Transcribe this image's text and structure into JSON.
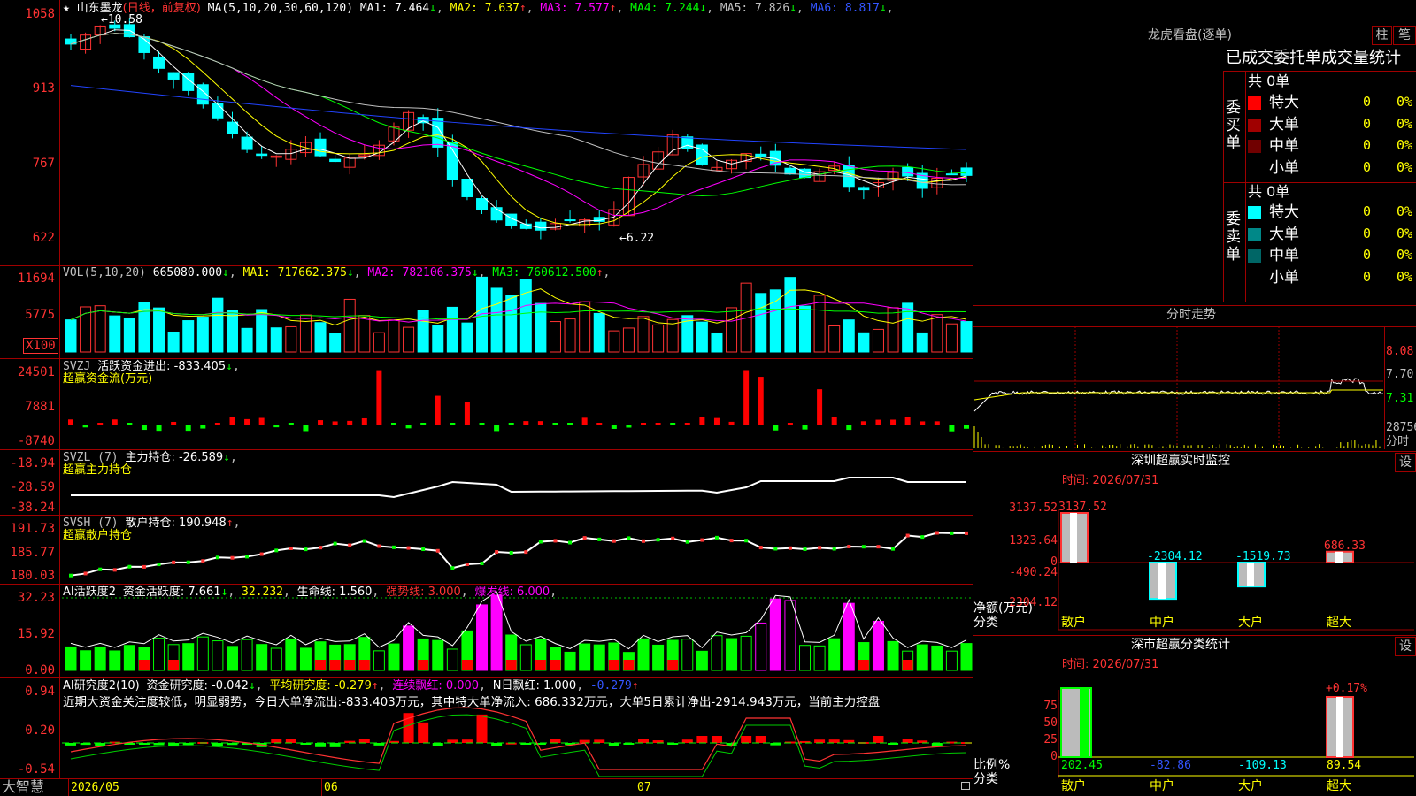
{
  "main": {
    "stock_name": "山东墨龙",
    "period": "(日线，前复权)",
    "ma_params": "MA(5,10,20,30,60,120)",
    "ma": [
      {
        "label": "MA1: 7.464",
        "arrow": "↓",
        "color": "#ffffff"
      },
      {
        "label": "MA2: 7.637",
        "arrow": "↑",
        "color": "#ffff00"
      },
      {
        "label": "MA3: 7.577",
        "arrow": "↑",
        "color": "#ff00ff"
      },
      {
        "label": "MA4: 7.244",
        "arrow": "↓",
        "color": "#00ff00"
      },
      {
        "label": "MA5: 7.826",
        "arrow": "↓",
        "color": "#c0c0c0"
      },
      {
        "label": "MA6: 8.817",
        "arrow": "↓",
        "color": "#3355ff"
      }
    ],
    "axis": [
      "1058",
      "913",
      "767",
      "622"
    ],
    "high_label": "10.58",
    "low_label": "6.22"
  },
  "vol": {
    "params": "VOL(5,10,20)",
    "value": "665080.000",
    "ma": [
      {
        "label": "MA1: 717662.375",
        "arrow": "↓",
        "color": "#ffff00"
      },
      {
        "label": "MA2: 782106.375",
        "arrow": "↓",
        "color": "#ff00ff"
      },
      {
        "label": "MA3: 760612.500",
        "arrow": "↑",
        "color": "#00ff00"
      }
    ],
    "axis": [
      "11694",
      "5775"
    ],
    "unit": "X100"
  },
  "svzj": {
    "name": "SVZJ",
    "label": "活跃资金进出: -833.405",
    "arrow": "↓",
    "sub": "超赢资金流(万元)",
    "axis": [
      "24501",
      "7881",
      "-8740"
    ]
  },
  "svzl": {
    "name": "SVZL (7)",
    "label": "主力持仓: -26.589",
    "arrow": "↓",
    "sub": "超赢主力持仓",
    "axis": [
      "-18.94",
      "-28.59",
      "-38.24"
    ]
  },
  "svsh": {
    "name": "SVSH (7)",
    "label": "散户持仓: 190.948",
    "arrow": "↑",
    "sub": "超赢散户持仓",
    "axis": [
      "191.73",
      "185.77",
      "180.03"
    ]
  },
  "ai1": {
    "name": "AI活跃度2",
    "label": "资金活跃度: 7.661",
    "v2": "32.232",
    "life": "生命线: 1.560",
    "strong": "强势线: 3.000",
    "burst": "爆发线: 6.000",
    "axis": [
      "32.23",
      "15.92",
      "0.00"
    ]
  },
  "ai2": {
    "name": "AI研究度2(10)",
    "label": "资金研究度: -0.042",
    "avg": "平均研究度: -0.279",
    "red": "连续飘红: 0.000",
    "nred": "N日飘红: 1.000",
    "last": "-0.279",
    "axis": [
      "0.94",
      "0.20",
      "-0.54"
    ],
    "summary": "近期大资金关注度较低，明显弱势，今日大单净流出:-833.403万元，其中特大单净流入: 686.332万元，大单5日累计净出-2914.943万元，当前主力控盘"
  },
  "dates": {
    "logo": "大智慧",
    "d1": "2026/05",
    "d2": "06",
    "d3": "07"
  },
  "right": {
    "title": "龙虎看盘(逐单)",
    "btn1": "柱",
    "btn2": "笔",
    "tabs": "已成交委托单成交量统计",
    "buy": {
      "side": "委买单",
      "total": "共 0单",
      "rows": [
        {
          "label": "特大",
          "v": "0",
          "p": "0%",
          "color": "#ff0000"
        },
        {
          "label": "大单",
          "v": "0",
          "p": "0%",
          "color": "#a00000"
        },
        {
          "label": "中单",
          "v": "0",
          "p": "0%",
          "color": "#700000"
        },
        {
          "label": "小单",
          "v": "0",
          "p": "0%",
          "color": "#000000"
        }
      ]
    },
    "sell": {
      "side": "委卖单",
      "total": "共 0单",
      "rows": [
        {
          "label": "特大",
          "v": "0",
          "p": "0%",
          "color": "#00ffff"
        },
        {
          "label": "大单",
          "v": "0",
          "p": "0%",
          "color": "#008888"
        },
        {
          "label": "中单",
          "v": "0",
          "p": "0%",
          "color": "#006666"
        },
        {
          "label": "小单",
          "v": "0",
          "p": "0%",
          "color": "#000000"
        }
      ]
    },
    "intraday": {
      "title": "分时走势",
      "axis": [
        "8.08",
        "7.70",
        "7.31"
      ],
      "vol": "28756",
      "unit": "分时"
    },
    "monitor": {
      "title": "深圳超赢实时监控",
      "btn": "设",
      "time": "时间: 2026/07/31",
      "axis": [
        "3137.52",
        "1323.64",
        "0",
        "-490.24",
        "-2304.12"
      ],
      "bars": [
        {
          "cat": "散户",
          "label": "3137.52",
          "value": 3137.52
        },
        {
          "cat": "中户",
          "label": "-2304.12",
          "value": -2304.12
        },
        {
          "cat": "大户",
          "label": "-1519.73",
          "value": -1519.73
        },
        {
          "cat": "超大",
          "label": "686.33",
          "value": 686.33
        }
      ],
      "unit": "净额(万元)",
      "cat_label": "分类"
    },
    "classify": {
      "title": "深市超赢分类统计",
      "btn": "设",
      "time": "时间: 2026/07/31",
      "axis": [
        "75",
        "50",
        "25",
        "0"
      ],
      "top": "+0.17%",
      "bars": [
        {
          "cat": "散户",
          "label": "202.45"
        },
        {
          "cat": "中户",
          "label": "-82.86"
        },
        {
          "cat": "大户",
          "label": "-109.13"
        },
        {
          "cat": "超大",
          "label": "89.54"
        }
      ],
      "unit": "比例%",
      "cat_label": "分类"
    }
  }
}
